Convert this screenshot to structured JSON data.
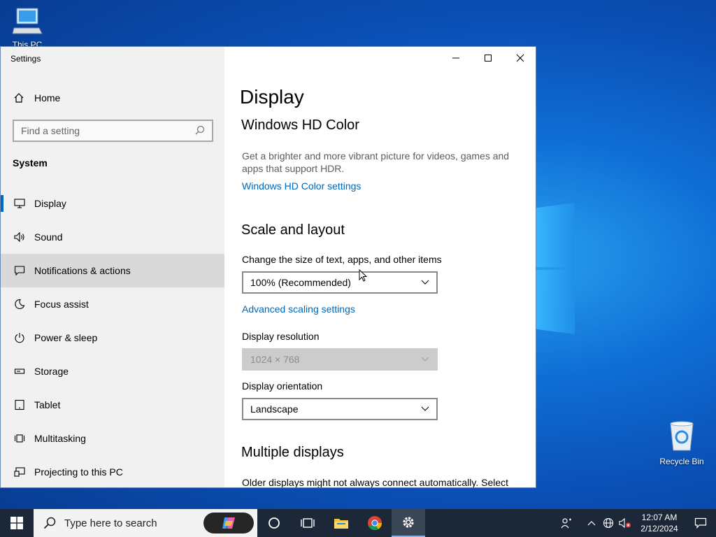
{
  "desktop": {
    "this_pc_label": "This PC",
    "recycle_bin_label": "Recycle Bin"
  },
  "window": {
    "title": "Settings",
    "controls": {
      "minimize": "minimize-icon",
      "maximize": "maximize-icon",
      "close": "close-icon"
    }
  },
  "sidebar": {
    "home_label": "Home",
    "search_placeholder": "Find a setting",
    "section_label": "System",
    "items": [
      {
        "label": "Display",
        "icon": "monitor-icon",
        "active": true
      },
      {
        "label": "Sound",
        "icon": "speaker-icon"
      },
      {
        "label": "Notifications & actions",
        "icon": "notification-icon",
        "hover": true
      },
      {
        "label": "Focus assist",
        "icon": "moon-icon"
      },
      {
        "label": "Power & sleep",
        "icon": "power-icon"
      },
      {
        "label": "Storage",
        "icon": "storage-icon"
      },
      {
        "label": "Tablet",
        "icon": "tablet-icon"
      },
      {
        "label": "Multitasking",
        "icon": "multitasking-icon"
      },
      {
        "label": "Projecting to this PC",
        "icon": "projecting-icon"
      }
    ]
  },
  "content": {
    "page_title": "Display",
    "hd_color": {
      "heading": "Windows HD Color",
      "description": "Get a brighter and more vibrant picture for videos, games and apps that support HDR.",
      "link": "Windows HD Color settings"
    },
    "scale": {
      "heading": "Scale and layout",
      "size_label": "Change the size of text, apps, and other items",
      "size_value": "100% (Recommended)",
      "advanced_link": "Advanced scaling settings",
      "resolution_label": "Display resolution",
      "resolution_value": "1024 × 768",
      "orientation_label": "Display orientation",
      "orientation_value": "Landscape"
    },
    "multiple": {
      "heading": "Multiple displays",
      "description": "Older displays might not always connect automatically. Select"
    }
  },
  "taskbar": {
    "search_placeholder": "Type here to search",
    "clock_time": "12:07 AM",
    "clock_date": "2/12/2024"
  },
  "colors": {
    "accent": "#0067c0",
    "link": "#0067b8",
    "taskbar": "#1c2838"
  }
}
